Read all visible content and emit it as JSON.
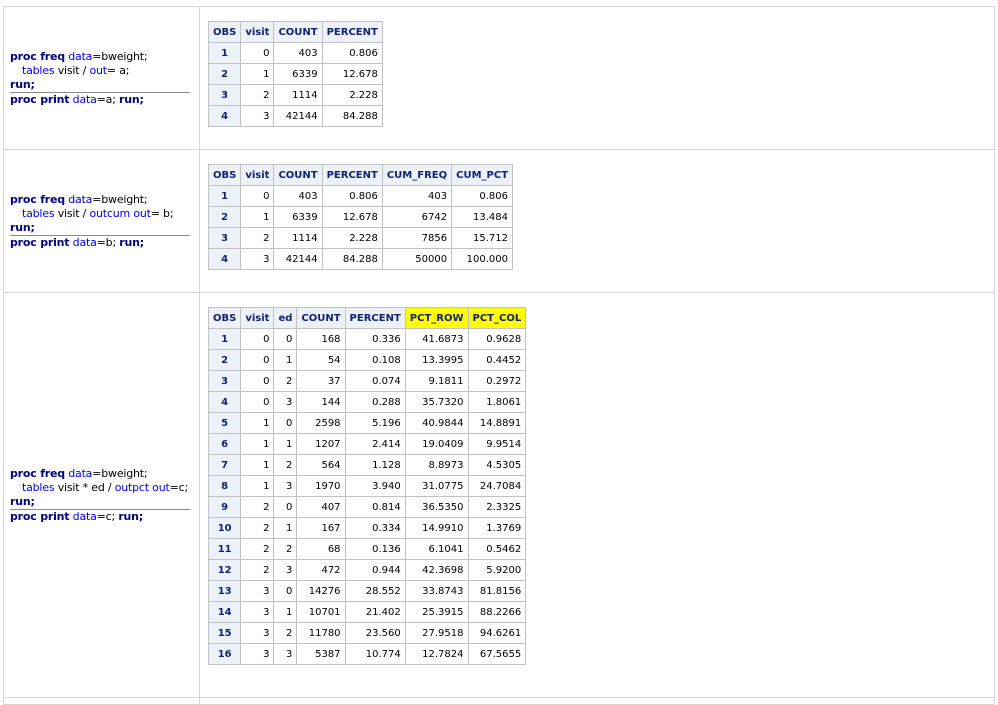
{
  "sections": [
    {
      "code": {
        "line1": [
          {
            "t": "proc freq",
            "c": "kw"
          },
          {
            "t": " data",
            "c": "opt"
          },
          {
            "t": "=bweight;",
            "c": "plain"
          }
        ],
        "line2": [
          {
            "t": "tables",
            "c": "opt"
          },
          {
            "t": " visit / ",
            "c": "plain"
          },
          {
            "t": "out",
            "c": "opt"
          },
          {
            "t": "= a;",
            "c": "plain"
          }
        ],
        "line3": [
          {
            "t": "run;",
            "c": "kw"
          }
        ],
        "line4": [
          {
            "t": "proc print",
            "c": "kw"
          },
          {
            "t": " data",
            "c": "opt"
          },
          {
            "t": "=a; ",
            "c": "plain"
          },
          {
            "t": "run;",
            "c": "kw"
          }
        ]
      },
      "table": {
        "headers": [
          "OBS",
          "visit",
          "COUNT",
          "PERCENT"
        ],
        "rows": [
          [
            "1",
            "0",
            "403",
            "0.806"
          ],
          [
            "2",
            "1",
            "6339",
            "12.678"
          ],
          [
            "3",
            "2",
            "1114",
            "2.228"
          ],
          [
            "4",
            "3",
            "42144",
            "84.288"
          ]
        ]
      }
    },
    {
      "code": {
        "line1": [
          {
            "t": "proc freq",
            "c": "kw"
          },
          {
            "t": " data",
            "c": "opt"
          },
          {
            "t": "=bweight;",
            "c": "plain"
          }
        ],
        "line2": [
          {
            "t": "tables",
            "c": "opt"
          },
          {
            "t": " visit / ",
            "c": "plain"
          },
          {
            "t": "outcum out",
            "c": "opt"
          },
          {
            "t": "= b;",
            "c": "plain"
          }
        ],
        "line3": [
          {
            "t": "run;",
            "c": "kw"
          }
        ],
        "line4": [
          {
            "t": "proc print",
            "c": "kw"
          },
          {
            "t": " data",
            "c": "opt"
          },
          {
            "t": "=b; ",
            "c": "plain"
          },
          {
            "t": "run;",
            "c": "kw"
          }
        ]
      },
      "table": {
        "headers": [
          "OBS",
          "visit",
          "COUNT",
          "PERCENT",
          "CUM_FREQ",
          "CUM_PCT"
        ],
        "rows": [
          [
            "1",
            "0",
            "403",
            "0.806",
            "403",
            "0.806"
          ],
          [
            "2",
            "1",
            "6339",
            "12.678",
            "6742",
            "13.484"
          ],
          [
            "3",
            "2",
            "1114",
            "2.228",
            "7856",
            "15.712"
          ],
          [
            "4",
            "3",
            "42144",
            "84.288",
            "50000",
            "100.000"
          ]
        ]
      }
    },
    {
      "code": {
        "line1": [
          {
            "t": "proc freq",
            "c": "kw"
          },
          {
            "t": " data",
            "c": "opt"
          },
          {
            "t": "=bweight;",
            "c": "plain"
          }
        ],
        "line2": [
          {
            "t": "tables",
            "c": "opt"
          },
          {
            "t": " visit * ed / ",
            "c": "plain"
          },
          {
            "t": "outpct out",
            "c": "opt"
          },
          {
            "t": "=c;",
            "c": "plain"
          }
        ],
        "line3": [
          {
            "t": "run;",
            "c": "kw"
          }
        ],
        "line4": [
          {
            "t": "proc print",
            "c": "kw"
          },
          {
            "t": " data",
            "c": "opt"
          },
          {
            "t": "=c; ",
            "c": "plain"
          },
          {
            "t": "run;",
            "c": "kw"
          }
        ]
      },
      "table": {
        "headers": [
          "OBS",
          "visit",
          "ed",
          "COUNT",
          "PERCENT",
          "PCT_ROW",
          "PCT_COL"
        ],
        "highlight_headers": [
          "PCT_ROW",
          "PCT_COL"
        ],
        "highlight_color": "#ffff00",
        "rows": [
          [
            "1",
            "0",
            "0",
            "168",
            "0.336",
            "41.6873",
            "0.9628"
          ],
          [
            "2",
            "0",
            "1",
            "54",
            "0.108",
            "13.3995",
            "0.4452"
          ],
          [
            "3",
            "0",
            "2",
            "37",
            "0.074",
            "9.1811",
            "0.2972"
          ],
          [
            "4",
            "0",
            "3",
            "144",
            "0.288",
            "35.7320",
            "1.8061"
          ],
          [
            "5",
            "1",
            "0",
            "2598",
            "5.196",
            "40.9844",
            "14.8891"
          ],
          [
            "6",
            "1",
            "1",
            "1207",
            "2.414",
            "19.0409",
            "9.9514"
          ],
          [
            "7",
            "1",
            "2",
            "564",
            "1.128",
            "8.8973",
            "4.5305"
          ],
          [
            "8",
            "1",
            "3",
            "1970",
            "3.940",
            "31.0775",
            "24.7084"
          ],
          [
            "9",
            "2",
            "0",
            "407",
            "0.814",
            "36.5350",
            "2.3325"
          ],
          [
            "10",
            "2",
            "1",
            "167",
            "0.334",
            "14.9910",
            "1.3769"
          ],
          [
            "11",
            "2",
            "2",
            "68",
            "0.136",
            "6.1041",
            "0.5462"
          ],
          [
            "12",
            "2",
            "3",
            "472",
            "0.944",
            "42.3698",
            "5.9200"
          ],
          [
            "13",
            "3",
            "0",
            "14276",
            "28.552",
            "33.8743",
            "81.8156"
          ],
          [
            "14",
            "3",
            "1",
            "10701",
            "21.402",
            "25.3915",
            "88.2266"
          ],
          [
            "15",
            "3",
            "2",
            "11780",
            "23.560",
            "27.9518",
            "94.6261"
          ],
          [
            "16",
            "3",
            "3",
            "5387",
            "10.774",
            "12.7824",
            "67.5655"
          ]
        ]
      }
    }
  ],
  "colors": {
    "keyword": "#000080",
    "option": "#0000ff",
    "header_bg": "#edf2f9",
    "header_text": "#112277",
    "highlight": "#ffff00"
  }
}
